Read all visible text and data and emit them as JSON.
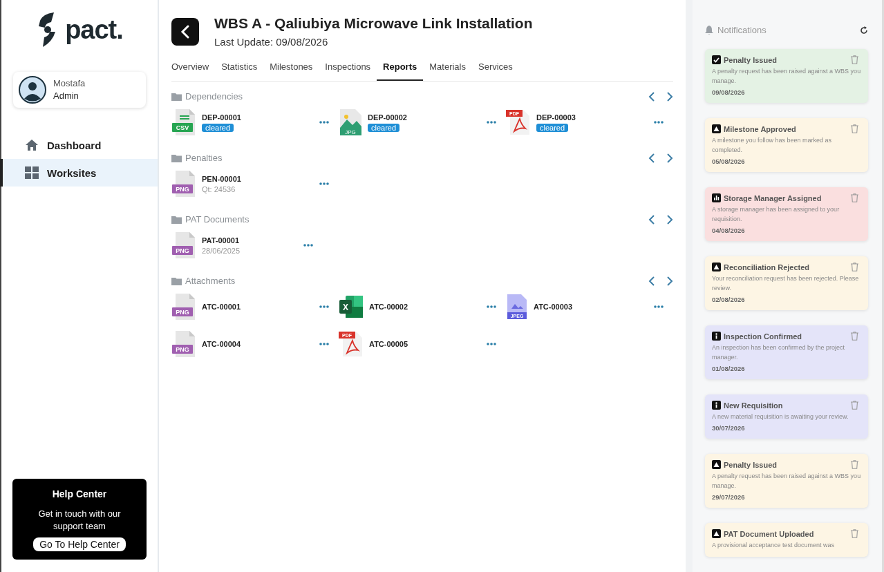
{
  "sidebar": {
    "logo": "pact.",
    "user": {
      "name": "Mostafa",
      "role": "Admin"
    },
    "items": [
      {
        "label": "Dashboard",
        "kind": "home",
        "selected": false
      },
      {
        "label": "Worksites",
        "kind": "grid",
        "selected": true
      }
    ],
    "help": {
      "title": "Help Center",
      "text": "Get in touch with our support team",
      "button": "Go To Help Center"
    }
  },
  "header": {
    "title": "WBS A - Qaliubiya Microwave Link Installation",
    "subtitle": "Last Update: 09/08/2026"
  },
  "tabs": [
    {
      "label": "Overview",
      "selected": false
    },
    {
      "label": "Statistics",
      "selected": false
    },
    {
      "label": "Milestones",
      "selected": false
    },
    {
      "label": "Inspections",
      "selected": false
    },
    {
      "label": "Reports",
      "selected": true
    },
    {
      "label": "Materials",
      "selected": false
    },
    {
      "label": "Services",
      "selected": false
    }
  ],
  "sections": [
    {
      "title": "Dependencies",
      "items": [
        {
          "kind": "csv",
          "icon_label": "CSV",
          "code": "DEP-00001",
          "badge": "cleared"
        },
        {
          "kind": "jpg",
          "icon_label": "JPG",
          "code": "DEP-00002",
          "badge": "cleared"
        },
        {
          "kind": "pdf",
          "icon_label": "PDF",
          "code": "DEP-00003",
          "badge": "cleared"
        }
      ]
    },
    {
      "title": "Penalties",
      "items": [
        {
          "kind": "png",
          "icon_label": "PNG",
          "code": "PEN-00001",
          "note": "Qt: 24536"
        }
      ]
    },
    {
      "title": "PAT Documents",
      "items": [
        {
          "kind": "png",
          "icon_label": "PNG",
          "code": "PAT-00001",
          "note": "28/06/2025"
        }
      ]
    },
    {
      "title": "Attachments",
      "items": [
        {
          "kind": "png",
          "icon_label": "PNG",
          "code": "ATC-00001"
        },
        {
          "kind": "xlsx",
          "icon_label": "X",
          "code": "ATC-00002"
        },
        {
          "kind": "jpeg",
          "icon_label": "JPEG",
          "code": "ATC-00003"
        },
        {
          "kind": "png",
          "icon_label": "PNG",
          "code": "ATC-00004"
        },
        {
          "kind": "pdf",
          "icon_label": "PDF",
          "code": "ATC-00005"
        }
      ]
    }
  ],
  "notifications": {
    "title": "Notifications",
    "items": [
      {
        "kind": "check",
        "color": "#e4f2e4",
        "title": "Penalty Issued",
        "text": "A penalty request has been raised against a WBS you manage.",
        "date": "09/08/2026"
      },
      {
        "kind": "warning",
        "color": "#fdf5e4",
        "title": "Milestone Approved",
        "text": "A milestone you follow has been marked as completed.",
        "date": "05/08/2026"
      },
      {
        "kind": "chart",
        "color": "#fadfdf",
        "title": "Storage Manager Assigned",
        "text": "A storage manager has been assigned to your requisition.",
        "date": "04/08/2026"
      },
      {
        "kind": "warning",
        "color": "#fdf5e4",
        "title": "Reconciliation Rejected",
        "text": "Your reconciliation request has been rejected. Please review.",
        "date": "02/08/2026"
      },
      {
        "kind": "info",
        "color": "#e4e4f9",
        "title": "Inspection Confirmed",
        "text": "An inspection has been confirmed by the project manager.",
        "date": "01/08/2026"
      },
      {
        "kind": "info",
        "color": "#e4e4f9",
        "title": "New Requisition",
        "text": "A new material requisition is awaiting your review.",
        "date": "30/07/2026"
      },
      {
        "kind": "warning",
        "color": "#fdf5e4",
        "title": "Penalty Issued",
        "text": "A penalty request has been raised against a WBS you manage.",
        "date": "29/07/2026"
      },
      {
        "kind": "warning",
        "color": "#fdf5e4",
        "title": "PAT Document Uploaded",
        "text": "A provisional acceptance test document was"
      }
    ]
  }
}
